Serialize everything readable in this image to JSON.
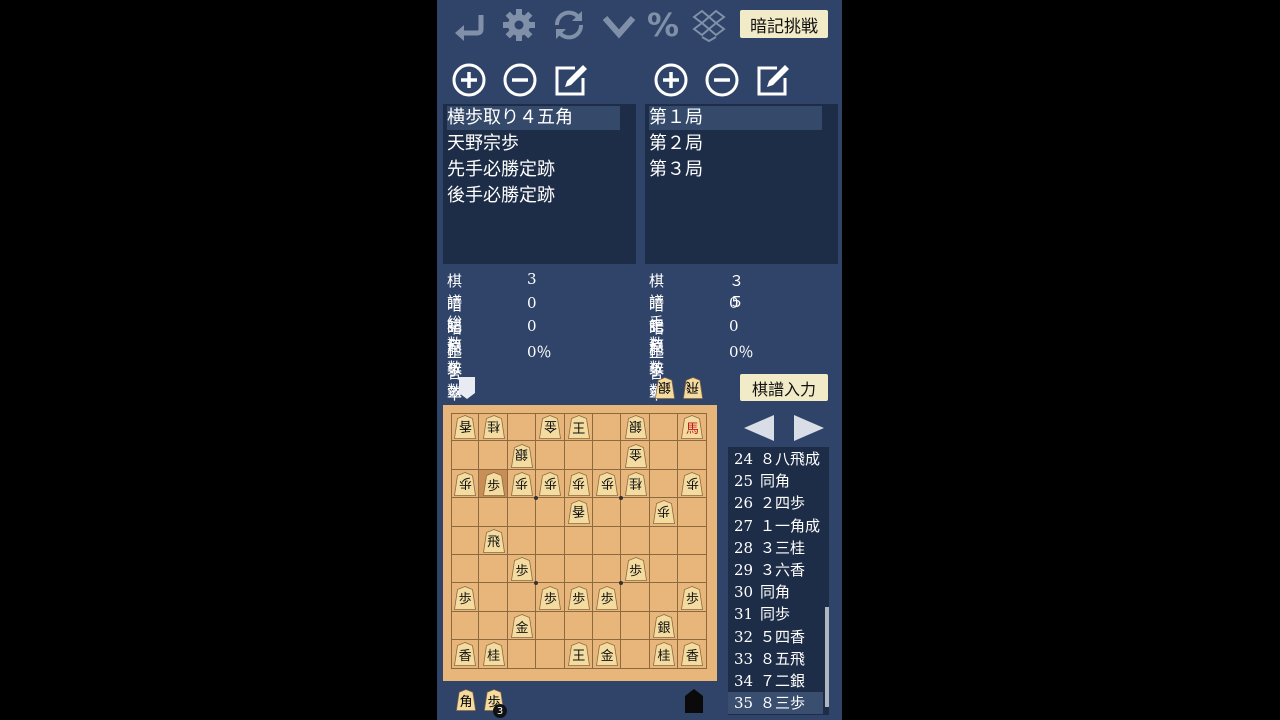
{
  "toolbar": {
    "icons": [
      "undo-icon",
      "gear-icon",
      "refresh-icon",
      "checkmark-icon",
      "percent-icon",
      "dropbox-icon"
    ],
    "percent_label": "%",
    "memo_challenge_label": "暗記挑戦"
  },
  "left_list": {
    "items": [
      "横歩取り４五角",
      "天野宗歩",
      "先手必勝定跡",
      "後手必勝定跡"
    ],
    "selected_index": 0
  },
  "right_list": {
    "items": [
      "第１局",
      "第２局",
      "第３局"
    ],
    "selected_index": 0
  },
  "left_stats": [
    {
      "label": "棋譜総数",
      "value": "3"
    },
    {
      "label": "暗記局数",
      "value": "0"
    },
    {
      "label": "暗記手数",
      "value": "0"
    },
    {
      "label": "正答率",
      "value": "0％"
    }
  ],
  "right_stats": [
    {
      "label": "棋譜手数",
      "value": "３５"
    },
    {
      "label": "暗記局数",
      "value": "0"
    },
    {
      "label": "暗記手数",
      "value": "0"
    },
    {
      "label": "正答率",
      "value": "0％"
    }
  ],
  "kifu_input_label": "棋譜入力",
  "gote_hand": [
    {
      "piece": "銀",
      "count": 1
    },
    {
      "piece": "飛",
      "count": 1
    }
  ],
  "sente_hand": [
    {
      "piece": "角",
      "count": 1
    },
    {
      "piece": "歩",
      "count": 3
    }
  ],
  "board": {
    "rows": [
      [
        "g:香",
        "g:桂",
        "",
        "g:金",
        "s:王",
        "",
        "g:銀",
        "",
        "s:馬"
      ],
      [
        "",
        "",
        "g:銀",
        "",
        "",
        "",
        "g:金",
        "",
        ""
      ],
      [
        "g:歩",
        "s:歩",
        "g:歩",
        "g:歩",
        "g:歩",
        "g:歩",
        "g:桂",
        "",
        "g:歩"
      ],
      [
        "",
        "",
        "",
        "",
        "g:香",
        "",
        "",
        "g:歩",
        ""
      ],
      [
        "",
        "s:飛",
        "",
        "",
        "",
        "",
        "",
        "",
        ""
      ],
      [
        "",
        "",
        "s:歩",
        "",
        "",
        "",
        "s:歩",
        "",
        ""
      ],
      [
        "s:歩",
        "",
        "",
        "s:歩",
        "s:歩",
        "s:歩",
        "",
        "",
        "s:歩"
      ],
      [
        "",
        "",
        "s:金",
        "",
        "",
        "",
        "",
        "s:銀",
        ""
      ],
      [
        "s:香",
        "s:桂",
        "",
        "",
        "s:王",
        "s:金",
        "",
        "s:桂",
        "s:香"
      ]
    ],
    "highlight": {
      "row": 2,
      "col": 1
    }
  },
  "moves": [
    {
      "n": "24",
      "text": "８八飛成"
    },
    {
      "n": "25",
      "text": "同角"
    },
    {
      "n": "26",
      "text": "２四歩"
    },
    {
      "n": "27",
      "text": "１一角成"
    },
    {
      "n": "28",
      "text": "３三桂"
    },
    {
      "n": "29",
      "text": "３六香"
    },
    {
      "n": "30",
      "text": "同角"
    },
    {
      "n": "31",
      "text": "同歩"
    },
    {
      "n": "32",
      "text": "５四香"
    },
    {
      "n": "33",
      "text": "８五飛"
    },
    {
      "n": "34",
      "text": "７二銀"
    },
    {
      "n": "35",
      "text": "８三歩"
    }
  ],
  "selected_move_index": 11,
  "colors": {
    "panel": "#2f4468",
    "list_bg": "#1e2d47",
    "board": "#e8b67a",
    "piece": "#f4dca0",
    "button": "#f2ebc8",
    "promoted": "#c01818"
  }
}
